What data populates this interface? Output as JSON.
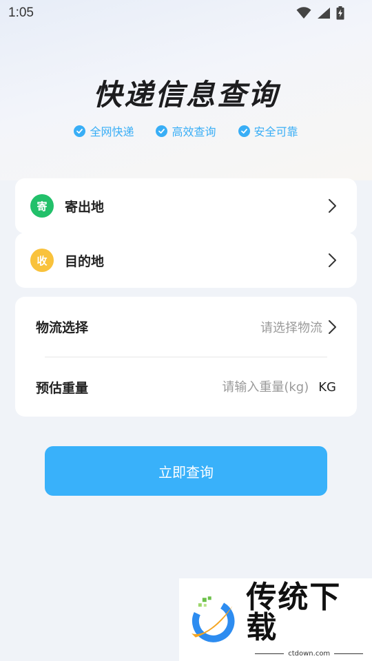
{
  "status_bar": {
    "time": "1:05"
  },
  "header": {
    "title": "快递信息查询",
    "features": [
      "全网快递",
      "高效查询",
      "安全可靠"
    ]
  },
  "addresses": {
    "sender": {
      "badge": "寄",
      "label": "寄出地",
      "badge_color": "#22c06a"
    },
    "receiver": {
      "badge": "收",
      "label": "目的地",
      "badge_color": "#f9c23c"
    }
  },
  "form": {
    "logistics_label": "物流选择",
    "logistics_placeholder": "请选择物流",
    "weight_label": "预估重量",
    "weight_placeholder": "请输入重量(kg)",
    "weight_unit": "KG"
  },
  "query_button": {
    "label": "立即查询",
    "color": "#39b1fa"
  },
  "watermark": {
    "title": "传统下载",
    "site": "ctdown.com"
  }
}
